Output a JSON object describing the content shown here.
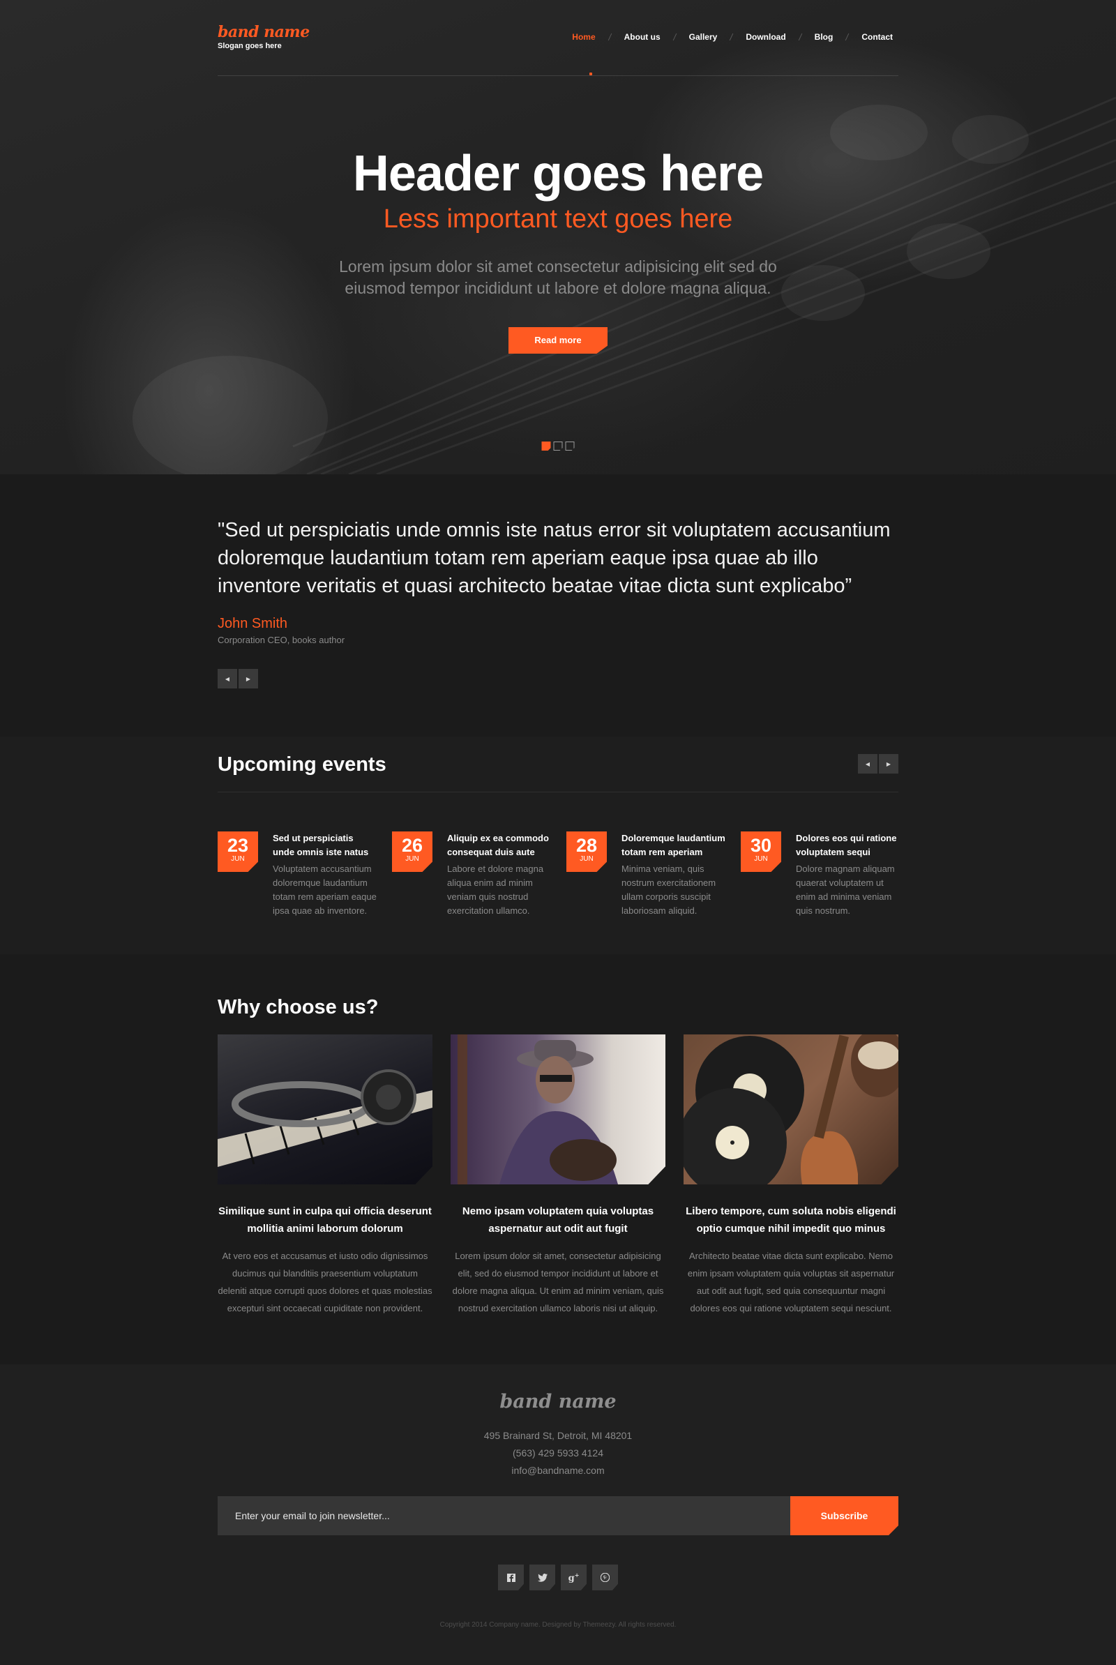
{
  "brand": {
    "logo": "band name",
    "slogan": "Slogan goes here"
  },
  "nav": {
    "items": [
      {
        "label": "Home",
        "active": true
      },
      {
        "label": "About us",
        "active": false
      },
      {
        "label": "Gallery",
        "active": false
      },
      {
        "label": "Download",
        "active": false
      },
      {
        "label": "Blog",
        "active": false
      },
      {
        "label": "Contact",
        "active": false
      }
    ]
  },
  "hero": {
    "title": "Header goes here",
    "subtitle": "Less important text goes here",
    "text": "Lorem ipsum dolor sit amet consectetur adipisicing elit sed do eiusmod tempor incididunt ut labore et dolore magna aliqua.",
    "button": "Read more",
    "slides_count": 3,
    "active_slide": 1
  },
  "testimonial": {
    "quote": "\"Sed ut perspiciatis unde omnis iste natus error sit voluptatem accusantium doloremque laudantium totam rem aperiam eaque ipsa quae ab illo inventore veritatis et quasi architecto beatae vitae dicta sunt explicabo”",
    "author": "John Smith",
    "role": "Corporation CEO, books author",
    "prev_icon": "caret-left-icon",
    "next_icon": "caret-right-icon"
  },
  "events": {
    "title": "Upcoming events",
    "items": [
      {
        "day": "23",
        "month": "JUN",
        "title": "Sed ut perspiciatis unde omnis iste natus",
        "text": "Voluptatem accusantium doloremque laudantium totam rem aperiam eaque ipsa quae ab inventore."
      },
      {
        "day": "26",
        "month": "JUN",
        "title": "Aliquip ex ea commodo consequat duis aute",
        "text": "Labore et dolore magna aliqua enim ad minim veniam quis nostrud exercitation ullamco."
      },
      {
        "day": "28",
        "month": "JUN",
        "title": "Doloremque laudantium totam rem aperiam",
        "text": "Minima veniam, quis nostrum exercitationem ullam corporis suscipit laboriosam aliquid."
      },
      {
        "day": "30",
        "month": "JUN",
        "title": "Dolores eos qui ratione voluptatem sequi",
        "text": "Dolore magnam aliquam quaerat voluptatem ut enim ad minima veniam quis nostrum."
      }
    ]
  },
  "why": {
    "title": "Why choose us?",
    "items": [
      {
        "image": "headphones-on-piano-photo",
        "title": "Similique sunt in culpa qui officia deserunt mollitia animi laborum dolorum",
        "text": "At vero eos et accusamus et iusto odio dignissimos ducimus qui blanditiis praesentium voluptatum deleniti atque corrupti quos dolores et quas molestias excepturi sint occaecati cupiditate non provident."
      },
      {
        "image": "guitarist-with-hat-photo",
        "title": "Nemo ipsam voluptatem quia voluptas aspernatur aut odit aut fugit",
        "text": "Lorem ipsum dolor sit amet, consectetur adipisicing elit, sed do eiusmod tempor incididunt ut labore et dolore magna aliqua. Ut enim ad minim veniam, quis nostrud exercitation ullamco laboris nisi ut aliquip."
      },
      {
        "image": "vinyl-records-and-guitar-photo",
        "title": "Libero tempore, cum soluta nobis eligendi optio cumque nihil impedit quo minus",
        "text": "Architecto beatae vitae dicta sunt explicabo. Nemo enim ipsam voluptatem quia voluptas sit aspernatur aut odit aut fugit, sed quia consequuntur magni dolores eos qui ratione voluptatem sequi nesciunt."
      }
    ]
  },
  "footer": {
    "logo": "band name",
    "address": "495 Brainard St, Detroit, MI 48201",
    "phone": "(563) 429 5933 4124",
    "email": "info@bandname.com",
    "newsletter_placeholder": "Enter your email to join newsletter...",
    "subscribe": "Subscribe",
    "socials": [
      {
        "icon": "facebook-icon",
        "glyph": "f"
      },
      {
        "icon": "twitter-icon",
        "glyph": "🐦"
      },
      {
        "icon": "google-plus-icon",
        "glyph": "g+"
      },
      {
        "icon": "pinterest-icon",
        "glyph": "p"
      }
    ],
    "copyright": "Copyright 2014 Company name. Designed by Themeezy. All rights reserved."
  },
  "colors": {
    "accent": "#ff5a22",
    "background": "#1b1b1b",
    "muted_text": "#8b8b8b"
  }
}
